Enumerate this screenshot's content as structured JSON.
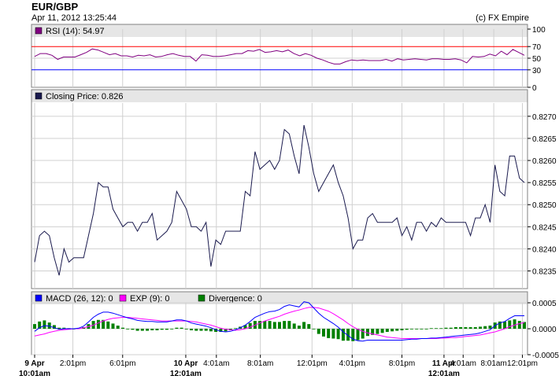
{
  "header": {
    "title": "EUR/GBP",
    "date": "Apr 11, 2012 13:25:44",
    "copyright": "(c) FX Empire"
  },
  "colors": {
    "rsi": "#800080",
    "price": "#1a1a4e",
    "macd": "#0000ff",
    "exp": "#ff00ff",
    "divergence": "#008000",
    "overbought": "#ff0000",
    "oversold": "#0000ff",
    "panel_header": "#e6e6e6"
  },
  "chart_data": [
    {
      "type": "line",
      "title": "RSI (14): 54.97",
      "ylim": [
        0,
        100
      ],
      "ticks": [
        "100",
        "70",
        "50",
        "30",
        "0"
      ],
      "tick_values": [
        100,
        70,
        50,
        30,
        0
      ],
      "reference_lines": [
        70,
        30
      ],
      "series": [
        {
          "name": "RSI (14)",
          "values": [
            53,
            58,
            58,
            55,
            48,
            52,
            52,
            52,
            56,
            60,
            66,
            64,
            60,
            56,
            58,
            54,
            54,
            52,
            55,
            54,
            56,
            52,
            53,
            56,
            58,
            55,
            53,
            53,
            45,
            56,
            55,
            53,
            53,
            54,
            56,
            58,
            58,
            63,
            62,
            65,
            60,
            61,
            63,
            61,
            64,
            58,
            54,
            58,
            55,
            50,
            47,
            43,
            40,
            40,
            44,
            47,
            46,
            47,
            46,
            46,
            46,
            48,
            45,
            49,
            47,
            48,
            49,
            48,
            47,
            49,
            49,
            48,
            48,
            49,
            47,
            42,
            53,
            52,
            53,
            57,
            54,
            62,
            56,
            65,
            60,
            55
          ]
        }
      ]
    },
    {
      "type": "line",
      "title": "Closing Price: 0.826",
      "ylim": [
        0.8231,
        0.8273
      ],
      "ticks": [
        "0.8270",
        "0.8265",
        "0.8260",
        "0.8255",
        "0.8250",
        "0.8245",
        "0.8240",
        "0.8235"
      ],
      "tick_values": [
        0.827,
        0.8265,
        0.826,
        0.8255,
        0.825,
        0.8245,
        0.824,
        0.8235
      ],
      "series": [
        {
          "name": "Closing Price",
          "values": [
            0.8237,
            0.8243,
            0.8244,
            0.8243,
            0.8238,
            0.8234,
            0.824,
            0.8237,
            0.8238,
            0.8238,
            0.8238,
            0.8243,
            0.8248,
            0.8255,
            0.8254,
            0.8254,
            0.8249,
            0.8247,
            0.8245,
            0.8246,
            0.8246,
            0.8244,
            0.8246,
            0.8246,
            0.8248,
            0.8242,
            0.8243,
            0.8244,
            0.8246,
            0.8253,
            0.8251,
            0.8249,
            0.8245,
            0.8245,
            0.8244,
            0.8246,
            0.8236,
            0.8242,
            0.8241,
            0.8244,
            0.8244,
            0.8244,
            0.8244,
            0.8253,
            0.8252,
            0.8262,
            0.8258,
            0.8259,
            0.826,
            0.8258,
            0.826,
            0.8267,
            0.8266,
            0.8261,
            0.8257,
            0.8268,
            0.8263,
            0.8257,
            0.8253,
            0.8255,
            0.8257,
            0.8259,
            0.8255,
            0.8252,
            0.8247,
            0.824,
            0.8242,
            0.8242,
            0.8247,
            0.8248,
            0.8246,
            0.8246,
            0.8246,
            0.8246,
            0.8247,
            0.8243,
            0.8245,
            0.8242,
            0.8246,
            0.8246,
            0.8244,
            0.8246,
            0.8245,
            0.8247,
            0.8246,
            0.8246,
            0.8246,
            0.8246,
            0.8246,
            0.8243,
            0.8247,
            0.8247,
            0.825,
            0.8246,
            0.8259,
            0.8253,
            0.8252,
            0.8261,
            0.8261,
            0.8256,
            0.8255
          ]
        }
      ]
    },
    {
      "type": "bar",
      "title": "MACD / EXP / Divergence",
      "ylim": [
        -0.0005,
        0.0005
      ],
      "ticks": [
        "0.0005",
        "0.0000",
        "-0.0005"
      ],
      "tick_values": [
        0.0005,
        0.0,
        -0.0005
      ],
      "legend": [
        {
          "label": "MACD (26, 12): 0",
          "color_key": "macd"
        },
        {
          "label": "EXP (9): 0",
          "color_key": "exp"
        },
        {
          "label": "Divergence: 0",
          "color_key": "divergence"
        }
      ],
      "series": [
        {
          "name": "MACD (26, 12)",
          "values": [
            -5e-05,
            2e-05,
            6e-05,
            5e-05,
            2e-05,
            -1e-05,
            0.0,
            0.0,
            0.0,
            1e-05,
            5e-05,
            0.00013,
            0.00022,
            0.00028,
            0.00032,
            0.00032,
            0.0003,
            0.00027,
            0.00024,
            0.00021,
            0.00019,
            0.00016,
            0.00015,
            0.00014,
            0.00014,
            0.00013,
            0.00013,
            0.00013,
            0.00015,
            0.00017,
            0.00017,
            0.00015,
            0.00011,
            9e-05,
            7e-05,
            5e-05,
            2e-05,
            -2e-05,
            -5e-05,
            -6e-05,
            -5e-05,
            -2e-05,
            2e-05,
            7e-05,
            0.00014,
            0.00022,
            0.00026,
            0.0003,
            0.00033,
            0.00034,
            0.00037,
            0.00043,
            0.00046,
            0.00044,
            0.00042,
            0.00052,
            0.0005,
            0.0004,
            0.0003,
            0.00022,
            0.00016,
            0.0001,
            3e-05,
            -6e-05,
            -0.00013,
            -0.0002,
            -0.00023,
            -0.00024,
            -0.00022,
            -0.00022,
            -0.00022,
            -0.00022,
            -0.00022,
            -0.00022,
            -0.00022,
            -0.00022,
            -0.00021,
            -0.0002,
            -0.0002,
            -0.00019,
            -0.00019,
            -0.00018,
            -0.00018,
            -0.00017,
            -0.00016,
            -0.00015,
            -0.00014,
            -0.00013,
            -0.00012,
            -0.00011,
            -0.0001,
            -8e-05,
            -5e-05,
            -2e-05,
            6e-05,
            0.00011,
            0.00014,
            0.0002,
            0.00025,
            0.00025,
            0.00025
          ]
        },
        {
          "name": "EXP (9)",
          "values": [
            -0.00014,
            -0.00012,
            -0.0001,
            -7e-05,
            -5e-05,
            -3e-05,
            -2e-05,
            -1e-05,
            0.0,
            0.0,
            2e-05,
            4e-05,
            7e-05,
            0.00011,
            0.00015,
            0.00018,
            0.0002,
            0.00021,
            0.00022,
            0.00022,
            0.00021,
            0.0002,
            0.00019,
            0.00018,
            0.00017,
            0.00016,
            0.00015,
            0.00015,
            0.00015,
            0.00015,
            0.00015,
            0.00015,
            0.00014,
            0.00013,
            0.00011,
            9e-05,
            7e-05,
            4e-05,
            1e-05,
            -1e-05,
            -2e-05,
            -3e-05,
            -2e-05,
            0.0,
            3e-05,
            7e-05,
            0.00011,
            0.00015,
            0.00018,
            0.00021,
            0.00024,
            0.00028,
            0.00031,
            0.00034,
            0.00036,
            0.00039,
            0.00041,
            0.00041,
            0.0004,
            0.00037,
            0.00034,
            0.00029,
            0.00023,
            0.00017,
            0.0001,
            4e-05,
            -1e-05,
            -5e-05,
            -8e-05,
            -0.0001,
            -0.00012,
            -0.00014,
            -0.00016,
            -0.00017,
            -0.00018,
            -0.00019,
            -0.00019,
            -0.00019,
            -0.00019,
            -0.00019,
            -0.00019,
            -0.00019,
            -0.00019,
            -0.00018,
            -0.00018,
            -0.00017,
            -0.00017,
            -0.00016,
            -0.00015,
            -0.00014,
            -0.00013,
            -0.00012,
            -0.0001,
            -8e-05,
            -6e-05,
            -3e-05,
            0.0,
            4e-05,
            7e-05,
            0.0001,
            0.00012
          ]
        },
        {
          "name": "Divergence",
          "values": [
            9e-05,
            0.00014,
            0.00016,
            0.00012,
            7e-05,
            2e-05,
            2e-05,
            1e-05,
            0.0,
            1e-05,
            3e-05,
            9e-05,
            0.00015,
            0.00017,
            0.00017,
            0.00014,
            0.0001,
            6e-05,
            2e-05,
            -1e-05,
            -2e-05,
            -4e-05,
            -4e-05,
            -4e-05,
            -3e-05,
            -3e-05,
            -2e-05,
            -2e-05,
            0.0,
            2e-05,
            2e-05,
            0.0,
            -3e-05,
            -4e-05,
            -4e-05,
            -4e-05,
            -5e-05,
            -6e-05,
            -6e-05,
            -5e-05,
            -3e-05,
            1e-05,
            4e-05,
            7e-05,
            0.00011,
            0.00015,
            0.00015,
            0.00015,
            0.00015,
            0.00013,
            0.00013,
            0.00015,
            0.00015,
            0.0001,
            6e-05,
            0.00013,
            9e-05,
            -1e-05,
            -0.0001,
            -0.00015,
            -0.00018,
            -0.00019,
            -0.0002,
            -0.00023,
            -0.00023,
            -0.00024,
            -0.00022,
            -0.00019,
            -0.00014,
            -0.00012,
            -0.0001,
            -8e-05,
            -6e-05,
            -5e-05,
            -4e-05,
            -3e-05,
            -2e-05,
            -1e-05,
            -1e-05,
            0.0,
            0.0,
            1e-05,
            1e-05,
            1e-05,
            2e-05,
            2e-05,
            3e-05,
            3e-05,
            3e-05,
            3e-05,
            3e-05,
            4e-05,
            5e-05,
            6e-05,
            0.00012,
            0.00014,
            0.00014,
            0.00016,
            0.00018,
            0.00015,
            0.00013
          ]
        }
      ]
    }
  ],
  "x_axis": {
    "ticks": [
      {
        "label": "9 Apr",
        "sub": "10:01am",
        "bold": true,
        "t": 0.0
      },
      {
        "label": "2:01pm",
        "t": 0.0781
      },
      {
        "label": "6:01pm",
        "t": 0.1797
      },
      {
        "label": "10 Apr",
        "sub": "12:01am",
        "bold": true,
        "t": 0.3086
      },
      {
        "label": "4:01am",
        "t": 0.3711
      },
      {
        "label": "8:01am",
        "t": 0.4609
      },
      {
        "label": "12:01pm",
        "t": 0.5664
      },
      {
        "label": "4:01pm",
        "t": 0.6484
      },
      {
        "label": "8:01pm",
        "t": 0.75
      },
      {
        "label": "11 Apr",
        "sub": "12:01am",
        "bold": true,
        "t": 0.8359
      },
      {
        "label": "4:01am",
        "t": 0.875
      },
      {
        "label": "8:01am",
        "t": 0.9375
      },
      {
        "label": "12:01pm",
        "t": 0.996
      }
    ]
  }
}
